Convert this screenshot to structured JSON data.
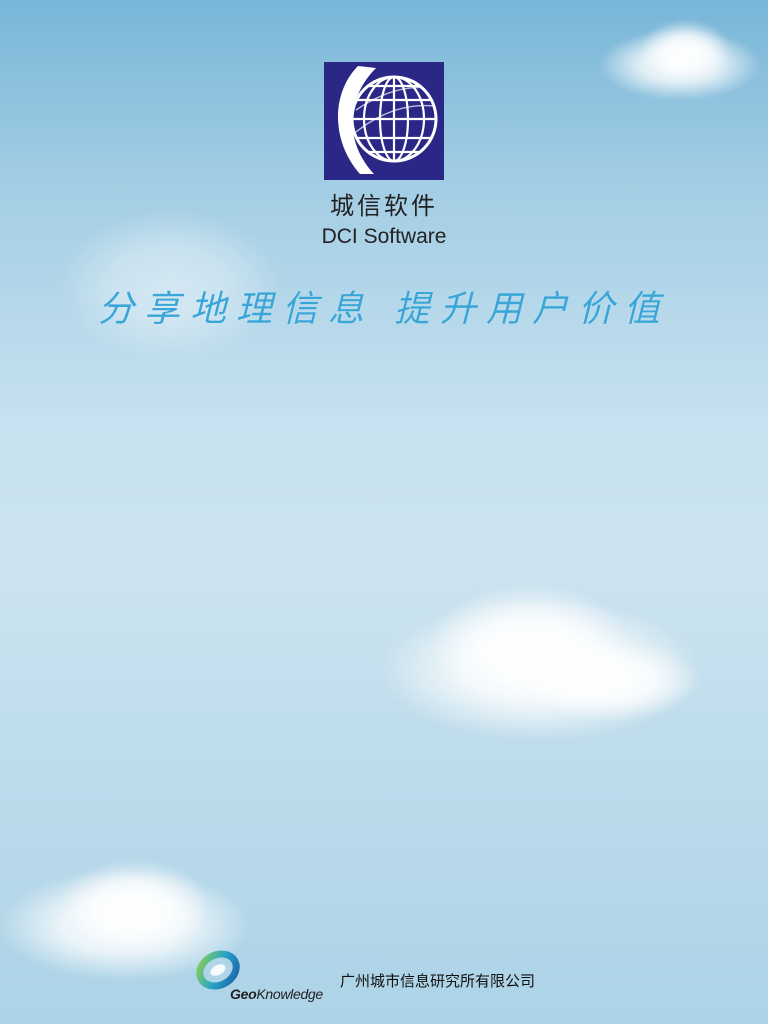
{
  "brand": {
    "name_cn": "城信软件",
    "name_en": "DCI Software",
    "logo_icon": "globe-logo-icon",
    "logo_color": "#2b2787"
  },
  "slogan": {
    "part1": "分享地理信息",
    "part2": "提升用户价值",
    "color": "#3aa6d8"
  },
  "footer": {
    "logo_icon": "geoknowledge-logo-icon",
    "brand_geo": "Geo",
    "brand_knowledge": "Knowledge",
    "company": "广州城市信息研究所有限公司"
  }
}
